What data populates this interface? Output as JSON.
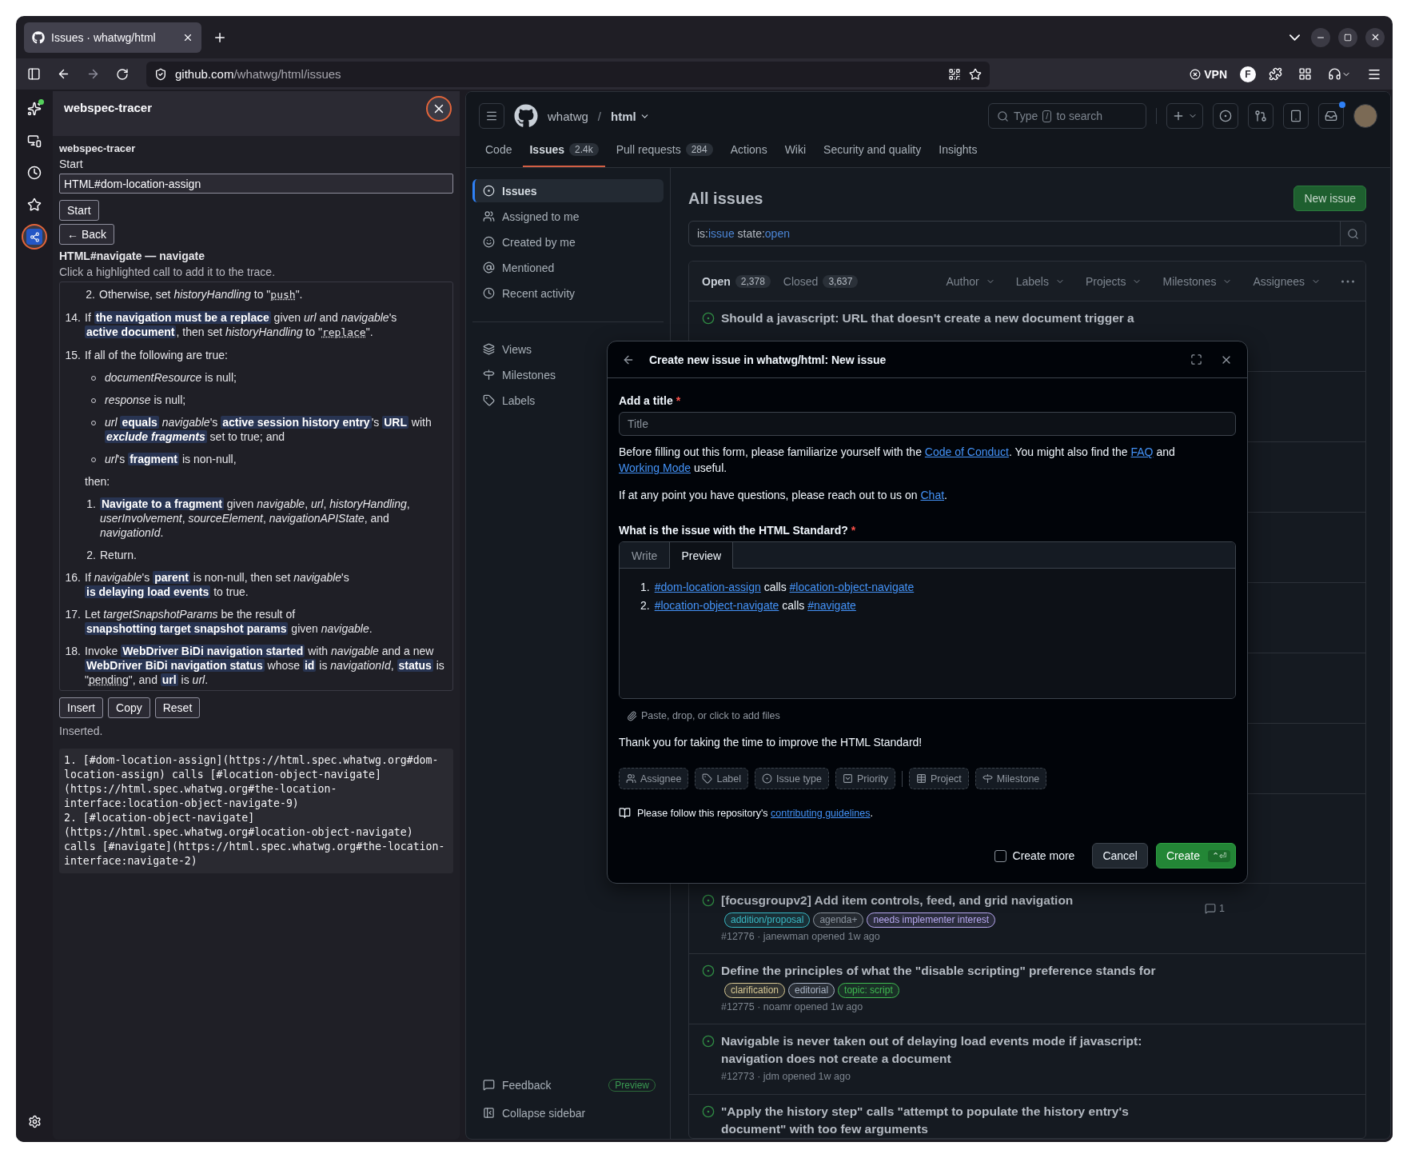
{
  "browser": {
    "tabs": [
      {
        "title": "Issues · whatwg/html",
        "selected": true
      }
    ],
    "url": {
      "host": "github.com",
      "path": "/whatwg/html/issues"
    },
    "vpn_label": "VPN",
    "profile_initial": "F"
  },
  "side_strip": {
    "items": [
      {
        "kind": "sparkle",
        "selected": false,
        "notification": true
      },
      {
        "kind": "devices",
        "selected": false,
        "notification": false
      },
      {
        "kind": "history",
        "selected": false,
        "notification": false
      },
      {
        "kind": "bookmarks",
        "selected": false,
        "notification": false
      },
      {
        "kind": "tracer",
        "selected": true,
        "notification": false
      }
    ]
  },
  "extension": {
    "title": "webspec-tracer",
    "heading": "webspec-tracer",
    "start_label": "Start",
    "start_value": "HTML#dom-location-assign",
    "start_button": "Start",
    "back_button": "← Back",
    "section_title": "HTML#navigate — navigate",
    "hint": "Click a highlighted call to add it to the trace.",
    "spec_steps": [
      {
        "kind": "group",
        "children": [
          {
            "kind": "numbered",
            "number": "2.",
            "segments": [
              {
                "kind": "text",
                "text": "Otherwise, set "
              },
              {
                "kind": "var",
                "text": "historyHandling"
              },
              {
                "kind": "text",
                "text": " to \""
              },
              {
                "kind": "code",
                "text": "push"
              },
              {
                "kind": "text",
                "text": "\"."
              }
            ]
          }
        ]
      },
      {
        "kind": "numbered",
        "number": "14.",
        "segments": [
          {
            "kind": "text",
            "text": "If "
          },
          {
            "kind": "call",
            "text": "the navigation must be a replace"
          },
          {
            "kind": "text",
            "text": " given "
          },
          {
            "kind": "var",
            "text": "url"
          },
          {
            "kind": "text",
            "text": " and "
          },
          {
            "kind": "var",
            "text": "navigable"
          },
          {
            "kind": "text",
            "text": "'s "
          },
          {
            "kind": "call",
            "text": "active document"
          },
          {
            "kind": "text",
            "text": ", then set "
          },
          {
            "kind": "var",
            "text": "historyHandling"
          },
          {
            "kind": "text",
            "text": " to \""
          },
          {
            "kind": "code",
            "text": "replace"
          },
          {
            "kind": "text",
            "text": "\"."
          }
        ]
      },
      {
        "kind": "numbered",
        "number": "15.",
        "segments": [
          {
            "kind": "text",
            "text": "If all of the following are true:"
          }
        ],
        "children": [
          {
            "kind": "bullet",
            "segments": [
              {
                "kind": "var",
                "text": "documentResource"
              },
              {
                "kind": "text",
                "text": " is null;"
              }
            ]
          },
          {
            "kind": "bullet",
            "segments": [
              {
                "kind": "var",
                "text": "response"
              },
              {
                "kind": "text",
                "text": " is null;"
              }
            ]
          },
          {
            "kind": "bullet",
            "segments": [
              {
                "kind": "var",
                "text": "url"
              },
              {
                "kind": "space"
              },
              {
                "kind": "call",
                "text": "equals"
              },
              {
                "kind": "space"
              },
              {
                "kind": "var",
                "text": "navigable"
              },
              {
                "kind": "text",
                "text": "'s "
              },
              {
                "kind": "call",
                "text": "active session history entry"
              },
              {
                "kind": "text",
                "text": "'s "
              },
              {
                "kind": "call",
                "text": "URL"
              },
              {
                "kind": "text",
                "text": " with "
              },
              {
                "kind": "callvar",
                "text": "exclude fragments"
              },
              {
                "kind": "text",
                "text": " set to true; and"
              }
            ]
          },
          {
            "kind": "bullet",
            "segments": [
              {
                "kind": "var",
                "text": "url"
              },
              {
                "kind": "text",
                "text": "'s "
              },
              {
                "kind": "call",
                "text": "fragment"
              },
              {
                "kind": "text",
                "text": " is non-null,"
              }
            ]
          },
          {
            "kind": "paragraph",
            "segments": [
              {
                "kind": "text",
                "text": "then:"
              }
            ]
          },
          {
            "kind": "numbered",
            "number": "1.",
            "segments": [
              {
                "kind": "call",
                "text": "Navigate to a fragment"
              },
              {
                "kind": "text",
                "text": " given "
              },
              {
                "kind": "var",
                "text": "navigable"
              },
              {
                "kind": "text",
                "text": ", "
              },
              {
                "kind": "var",
                "text": "url"
              },
              {
                "kind": "text",
                "text": ", "
              },
              {
                "kind": "var",
                "text": "historyHandling"
              },
              {
                "kind": "text",
                "text": ", "
              },
              {
                "kind": "var",
                "text": "userInvolvement"
              },
              {
                "kind": "text",
                "text": ", "
              },
              {
                "kind": "var",
                "text": "sourceElement"
              },
              {
                "kind": "text",
                "text": ", "
              },
              {
                "kind": "var",
                "text": "navigationAPIState"
              },
              {
                "kind": "text",
                "text": ", and "
              },
              {
                "kind": "var",
                "text": "navigationId"
              },
              {
                "kind": "text",
                "text": "."
              }
            ]
          },
          {
            "kind": "numbered",
            "number": "2.",
            "segments": [
              {
                "kind": "text",
                "text": "Return."
              }
            ]
          }
        ]
      },
      {
        "kind": "numbered",
        "number": "16.",
        "segments": [
          {
            "kind": "text",
            "text": "If "
          },
          {
            "kind": "var",
            "text": "navigable"
          },
          {
            "kind": "text",
            "text": "'s "
          },
          {
            "kind": "call",
            "text": "parent"
          },
          {
            "kind": "text",
            "text": " is non-null, then set "
          },
          {
            "kind": "var",
            "text": "navigable"
          },
          {
            "kind": "text",
            "text": "'s "
          },
          {
            "kind": "call",
            "text": "is delaying load events"
          },
          {
            "kind": "text",
            "text": " to true."
          }
        ]
      },
      {
        "kind": "numbered",
        "number": "17.",
        "segments": [
          {
            "kind": "text",
            "text": "Let "
          },
          {
            "kind": "var",
            "text": "targetSnapshotParams"
          },
          {
            "kind": "text",
            "text": " be the result of "
          },
          {
            "kind": "call",
            "text": "snapshotting target snapshot params"
          },
          {
            "kind": "text",
            "text": " given "
          },
          {
            "kind": "var",
            "text": "navigable"
          },
          {
            "kind": "text",
            "text": "."
          }
        ]
      },
      {
        "kind": "numbered",
        "number": "18.",
        "segments": [
          {
            "kind": "text",
            "text": "Invoke "
          },
          {
            "kind": "call",
            "text": "WebDriver BiDi navigation started"
          },
          {
            "kind": "text",
            "text": " with "
          },
          {
            "kind": "var",
            "text": "navigable"
          },
          {
            "kind": "text",
            "text": " and a new "
          },
          {
            "kind": "call",
            "text": "WebDriver BiDi navigation status"
          },
          {
            "kind": "text",
            "text": " whose "
          },
          {
            "kind": "call",
            "text": "id"
          },
          {
            "kind": "text",
            "text": " is "
          },
          {
            "kind": "var",
            "text": "navigationId"
          },
          {
            "kind": "text",
            "text": ", "
          },
          {
            "kind": "call",
            "text": "status"
          },
          {
            "kind": "text",
            "text": " is \""
          },
          {
            "kind": "term",
            "text": "pending"
          },
          {
            "kind": "text",
            "text": "\", and "
          },
          {
            "kind": "call",
            "text": "url"
          },
          {
            "kind": "text",
            "text": " is "
          },
          {
            "kind": "var",
            "text": "url"
          },
          {
            "kind": "text",
            "text": "."
          }
        ]
      }
    ],
    "actions": [
      "Insert",
      "Copy",
      "Reset"
    ],
    "status": "Inserted.",
    "output": "1. [#dom-location-assign](https://html.spec.whatwg.org#dom-location-assign) calls [#location-object-navigate](https://html.spec.whatwg.org#the-location-interface:location-object-navigate-9)\n2. [#location-object-navigate](https://html.spec.whatwg.org#location-object-navigate) calls [#navigate](https://html.spec.whatwg.org#the-location-interface:navigate-2)"
  },
  "github": {
    "owner": "whatwg",
    "path_separator": "/",
    "repo": "html",
    "search_hint": {
      "before": "Type",
      "key": "/",
      "after": "to search"
    },
    "nav": [
      {
        "label": "Code",
        "selected": false
      },
      {
        "label": "Issues",
        "count": "2.4k",
        "selected": true
      },
      {
        "label": "Pull requests",
        "count": "284",
        "selected": false
      },
      {
        "label": "Actions",
        "selected": false
      },
      {
        "label": "Wiki",
        "selected": false
      },
      {
        "label": "Security and quality",
        "selected": false
      },
      {
        "label": "Insights",
        "selected": false
      }
    ],
    "sidebar": {
      "items": [
        {
          "kind": "issues",
          "label": "Issues",
          "selected": true
        },
        {
          "kind": "assigned",
          "label": "Assigned to me",
          "selected": false
        },
        {
          "kind": "created",
          "label": "Created by me",
          "selected": false
        },
        {
          "kind": "mentioned",
          "label": "Mentioned",
          "selected": false
        },
        {
          "kind": "recent",
          "label": "Recent activity",
          "selected": false
        }
      ],
      "views": [
        {
          "kind": "views",
          "label": "Views",
          "selected": false
        },
        {
          "kind": "milestones",
          "label": "Milestones",
          "selected": false
        },
        {
          "kind": "labels",
          "label": "Labels",
          "selected": false
        }
      ],
      "feedback": {
        "label": "Feedback",
        "badge": "Preview"
      },
      "collapse": "Collapse sidebar"
    },
    "main": {
      "title": "All issues",
      "new_button": "New issue",
      "query": [
        {
          "kind": "key",
          "text": "is:"
        },
        {
          "kind": "value",
          "text": "issue"
        },
        {
          "kind": "key",
          "text": " state:"
        },
        {
          "kind": "value",
          "text": "open"
        }
      ],
      "states": [
        {
          "label": "Open",
          "count": "2,378",
          "selected": true
        },
        {
          "label": "Closed",
          "count": "3,637",
          "selected": false
        }
      ],
      "filters": [
        "Author",
        "Labels",
        "Projects",
        "Milestones",
        "Assignees"
      ],
      "issues": [
        {
          "title": "Should a javascript: URL that doesn't create a new document trigger a"
        },
        {
          "title": "[focusgroupv2] Add item controls, feed, and grid navigation",
          "labels": [
            {
              "name": "addition/proposal",
              "color": "#39b8c4"
            },
            {
              "name": "agenda+",
              "color": "#8b949e"
            },
            {
              "name": "needs implementer interest",
              "color": "#b7a8f0"
            }
          ],
          "meta": "#12776 · janewman opened 1w ago",
          "comments": "1"
        },
        {
          "title": "Define the principles of what the \"disable scripting\" preference stands for",
          "labels": [
            {
              "name": "clarification",
              "color": "#d6c793"
            },
            {
              "name": "editorial",
              "color": "#a9b4c4"
            },
            {
              "name": "topic: script",
              "color": "#3fb950"
            }
          ],
          "meta": "#12775 · noamr opened 1w ago"
        },
        {
          "title": "Navigable is never taken out of delaying load events mode if javascript: navigation does not create a document",
          "meta": "#12773 · jdm opened 1w ago"
        },
        {
          "title": "\"Apply the history step\" calls \"attempt to populate the history entry's document\" with too few arguments"
        }
      ]
    }
  },
  "modal": {
    "title": "Create new issue in whatwg/html: New issue",
    "title_field": {
      "label": "Add a title",
      "required_mark": "*",
      "placeholder": "Title"
    },
    "intro": [
      {
        "kind": "text",
        "text": "Before filling out this form, please familiarize yourself with the "
      },
      {
        "kind": "link",
        "text": "Code of Conduct"
      },
      {
        "kind": "text",
        "text": ". You might also find the "
      },
      {
        "kind": "link",
        "text": "FAQ"
      },
      {
        "kind": "text",
        "text": " and "
      },
      {
        "kind": "link",
        "text": "Working Mode"
      },
      {
        "kind": "text",
        "text": " useful."
      }
    ],
    "help": [
      {
        "kind": "text",
        "text": "If at any point you have questions, please reach out to us on "
      },
      {
        "kind": "link",
        "text": "Chat"
      },
      {
        "kind": "text",
        "text": "."
      }
    ],
    "body_field": {
      "label": "What is the issue with the HTML Standard?",
      "required_mark": "*",
      "tabs": [
        {
          "label": "Write",
          "selected": false
        },
        {
          "label": "Preview",
          "selected": true
        }
      ],
      "preview": [
        {
          "number": "1.",
          "segments": [
            {
              "kind": "link",
              "text": "#dom-location-assign"
            },
            {
              "kind": "text",
              "text": " calls "
            },
            {
              "kind": "link",
              "text": "#location-object-navigate"
            }
          ]
        },
        {
          "number": "2.",
          "segments": [
            {
              "kind": "link",
              "text": "#location-object-navigate"
            },
            {
              "kind": "text",
              "text": " calls "
            },
            {
              "kind": "link",
              "text": "#navigate"
            }
          ]
        }
      ],
      "attach_hint": "Paste, drop, or click to add files"
    },
    "thanks": "Thank you for taking the time to improve the HTML Standard!",
    "metadata": [
      {
        "kind": "assignee",
        "label": "Assignee"
      },
      {
        "kind": "label",
        "label": "Label"
      },
      {
        "kind": "issue-type",
        "label": "Issue type"
      },
      {
        "kind": "priority",
        "label": "Priority"
      },
      {
        "kind": "separator"
      },
      {
        "kind": "project",
        "label": "Project"
      },
      {
        "kind": "milestone",
        "label": "Milestone"
      }
    ],
    "guidelines": [
      {
        "kind": "text",
        "text": "Please follow this repository's "
      },
      {
        "kind": "link",
        "text": "contributing guidelines"
      },
      {
        "kind": "text",
        "text": "."
      }
    ],
    "create_more": {
      "label": "Create more",
      "checked": false
    },
    "cancel": "Cancel",
    "create": {
      "label": "Create",
      "shortcut": "⌃⏎"
    }
  }
}
